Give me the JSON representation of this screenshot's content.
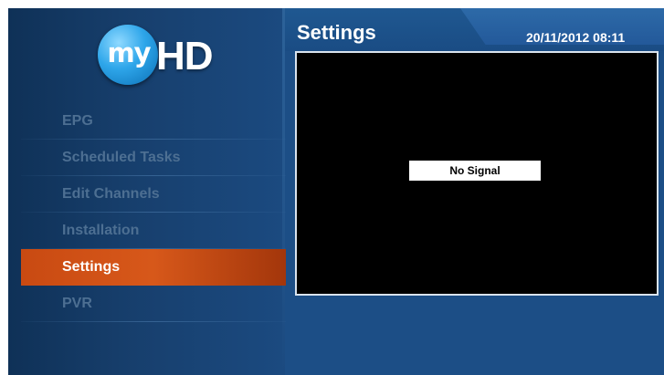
{
  "logo": {
    "my": "my",
    "hd": "HD"
  },
  "menu": {
    "items": [
      {
        "label": "EPG"
      },
      {
        "label": "Scheduled Tasks"
      },
      {
        "label": "Edit Channels"
      },
      {
        "label": "Installation"
      },
      {
        "label": "Settings",
        "active": true
      },
      {
        "label": "PVR"
      }
    ]
  },
  "header": {
    "title": "Settings",
    "datetime": "20/11/2012 08:11"
  },
  "preview": {
    "status": "No Signal"
  },
  "colors": {
    "active_item": "#d7581a",
    "background": "#1c4e86",
    "inactive_text": "#4d6f92"
  }
}
